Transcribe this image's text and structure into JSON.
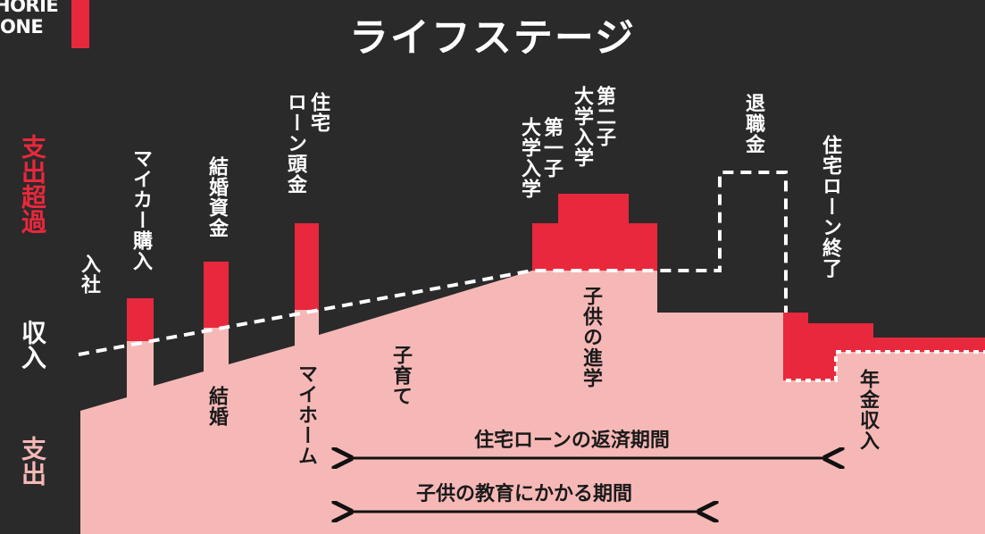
{
  "header": {
    "logo_line1": "HORIE",
    "logo_line2": "ONE",
    "title": "ライフステージ"
  },
  "legend": {
    "expense_over": "支出超過",
    "income": "収入",
    "expense": "支出"
  },
  "events_top": {
    "entry": "入社",
    "car": "マイカー購入",
    "wedding_fund": "結婚資金",
    "home_down_payment_line1": "住宅",
    "home_down_payment_line2": "ローン頭金",
    "univ1_line1": "第一子",
    "univ1_line2": "大学入学",
    "univ2_line1": "第二子",
    "univ2_line2": "大学入学",
    "retirement_pay": "退職金",
    "mortgage_end": "住宅ローン終了"
  },
  "events_bottom": {
    "marriage": "結婚",
    "my_home": "マイホーム",
    "child_rearing": "子育て",
    "child_advancement": "子供の進学",
    "pension": "年金収入"
  },
  "periods": {
    "mortgage_period": "住宅ローンの返済期間",
    "education_period": "子供の教育にかかる期間"
  },
  "colors": {
    "background": "#2a2a2a",
    "expense_pink": "#f6b8b6",
    "deficit_red": "#e8283c",
    "text_white": "#ffffff",
    "text_dark": "#1a1a1a"
  }
}
